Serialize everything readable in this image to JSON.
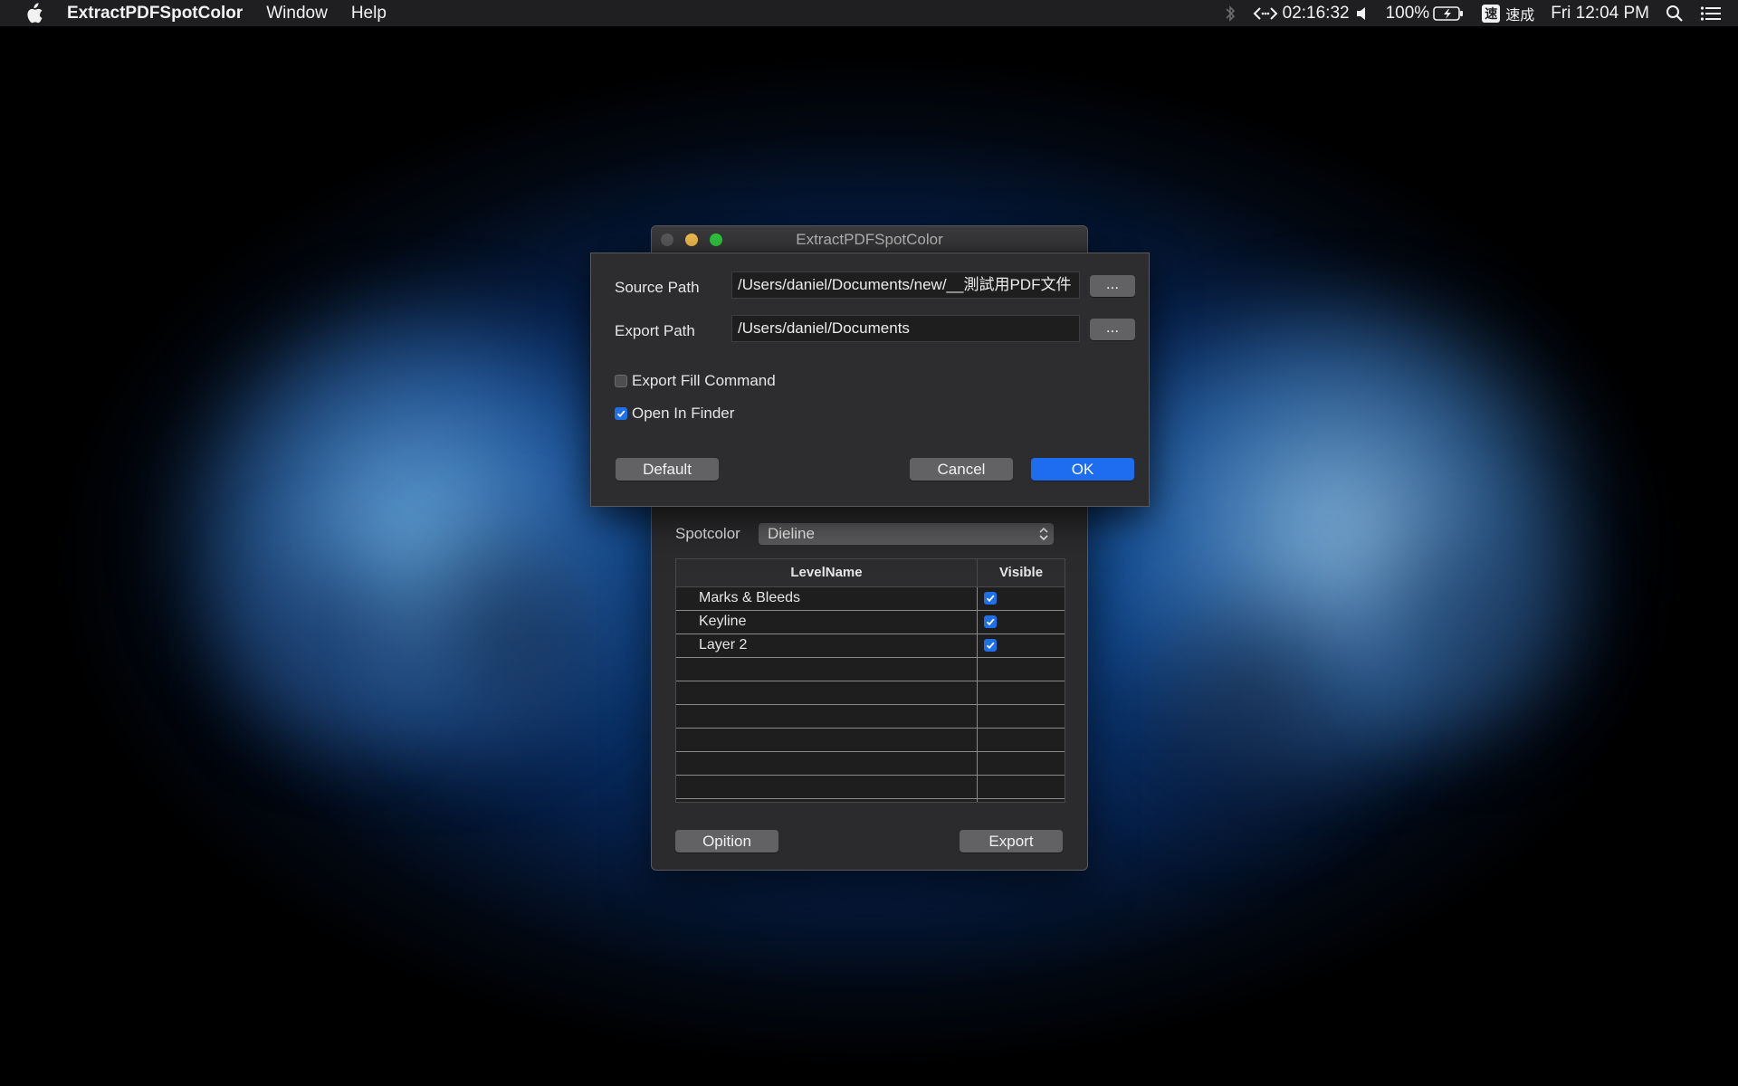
{
  "menubar": {
    "app_name": "ExtractPDFSpotColor",
    "menus": [
      "Window",
      "Help"
    ],
    "status": {
      "timer": "02:16:32",
      "battery": "100%",
      "input_method": "速成",
      "input_badge": "速",
      "clock": "Fri 12:04 PM"
    }
  },
  "main_window": {
    "title": "ExtractPDFSpotColor",
    "spotcolor_label": "Spotcolor",
    "spotcolor_value": "Dieline",
    "table": {
      "headers": [
        "LevelName",
        "Visible"
      ],
      "rows": [
        {
          "name": "Marks & Bleeds",
          "visible": true
        },
        {
          "name": "Keyline",
          "visible": true
        },
        {
          "name": "Layer 2",
          "visible": true
        }
      ]
    },
    "option_button": "Opition",
    "export_button": "Export"
  },
  "options_sheet": {
    "source_label": "Source Path",
    "source_value": "/Users/daniel/Documents/new/__測試用PDF文件",
    "source_browse": "...",
    "export_label": "Export Path",
    "export_value": "/Users/daniel/Documents",
    "export_browse": "...",
    "export_fill_label": "Export Fill Command",
    "export_fill_checked": false,
    "open_finder_label": "Open In Finder",
    "open_finder_checked": true,
    "default_button": "Default",
    "cancel_button": "Cancel",
    "ok_button": "OK"
  },
  "colors": {
    "accent": "#1e6cf0",
    "window_bg": "#2b2b2d",
    "menubar_bg": "#1f1f21"
  }
}
